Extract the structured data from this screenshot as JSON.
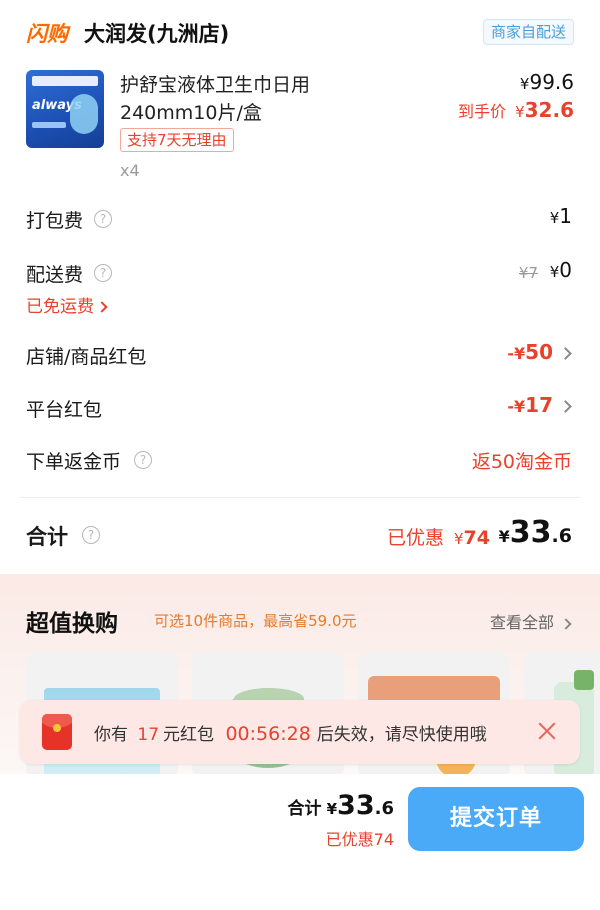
{
  "store": {
    "brand_tag": "闪购",
    "name": "大润发(九洲店)",
    "delivery_badge": "商家自配送"
  },
  "product": {
    "name_line1": "护舒宝液体卫生巾日用",
    "name_line2": "240mm10片/盒",
    "tag": "支持7天无理由",
    "qty": "x4",
    "price_symbol": "¥",
    "price": "99.6",
    "final_label": "到手价",
    "final_symbol": "¥",
    "final_price": "32.6",
    "package_text": "always"
  },
  "fees": {
    "packing": {
      "label": "打包费",
      "symbol": "¥",
      "value": "1"
    },
    "delivery": {
      "label": "配送费",
      "original_symbol": "¥",
      "original": "7",
      "symbol": "¥",
      "value": "0",
      "note": "已免运费"
    },
    "store_coupon": {
      "label": "店铺/商品红包",
      "prefix": "-¥",
      "value": "50"
    },
    "platform_coupon": {
      "label": "平台红包",
      "prefix": "-¥",
      "value": "17"
    },
    "coins": {
      "label": "下单返金币",
      "value": "返50淘金币"
    }
  },
  "total": {
    "label": "合计",
    "discount_label": "已优惠",
    "discount_symbol": "¥",
    "discount_value": "74",
    "symbol": "¥",
    "int": "33",
    "dec": ".6"
  },
  "upsell": {
    "title": "超值换购",
    "subtitle": "可选10件商品，最高省59.0元",
    "view_all": "查看全部"
  },
  "toast": {
    "pre": "你有",
    "amount": "17",
    "mid": "元红包",
    "countdown": "00:56:28",
    "post": "后失效，请尽快使用哦"
  },
  "bottom": {
    "total_label": "合计",
    "symbol": "¥",
    "int": "33",
    "dec": ".6",
    "discount_label": "已优惠",
    "discount_value": "74",
    "submit": "提交订单"
  },
  "colors": {
    "accent_red": "#e8412c",
    "brand_orange": "#ff6a00",
    "submit_blue": "#4aaaf7"
  }
}
